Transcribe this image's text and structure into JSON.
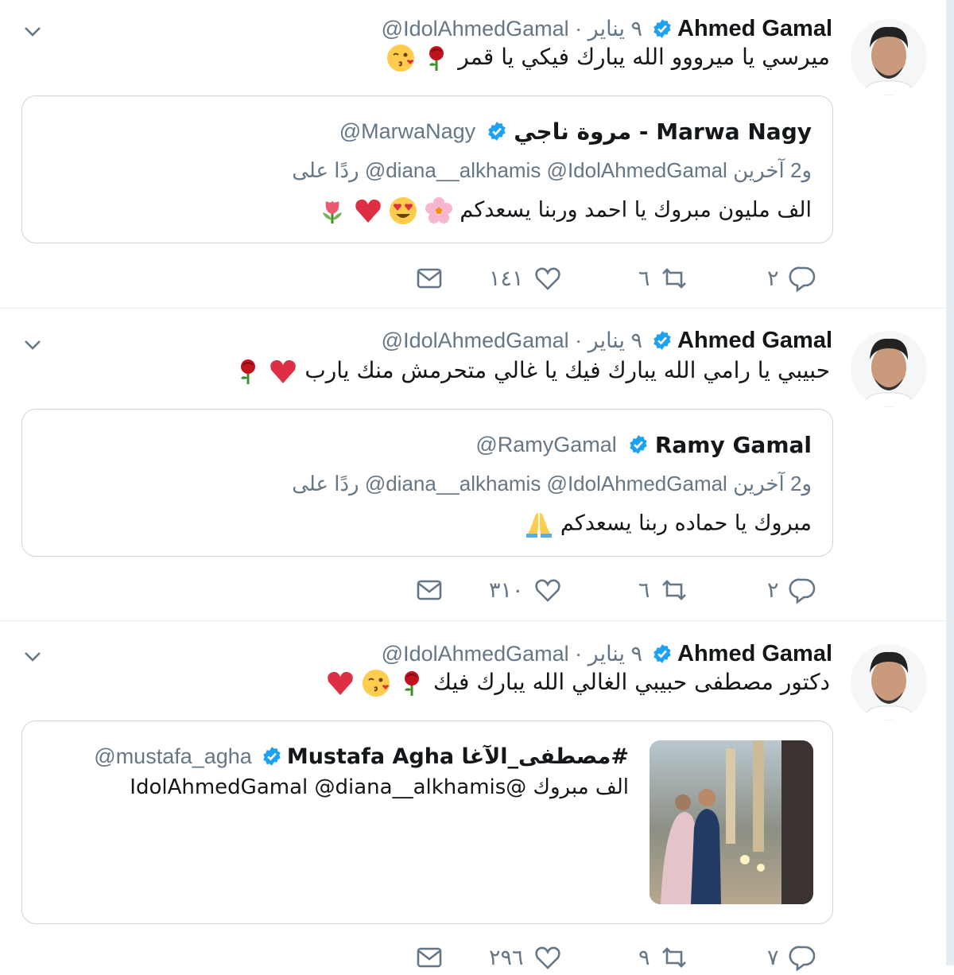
{
  "colors": {
    "verified": "#1da1f2",
    "muted": "#657786",
    "border": "#ccd6dd",
    "heart": "#e0245e"
  },
  "tweets": [
    {
      "name": "Ahmed Gamal",
      "meta": "@IdolAhmedGamal · ٩ يناير",
      "text": "ميرسي يا ميرووو الله يبارك فيكي يا قمر",
      "emojis": [
        "rose-icon",
        "kiss-face-icon"
      ],
      "quote": {
        "name": "مروة ناجي - Marwa Nagy",
        "handle": "@MarwaNagy",
        "replying": "ردًا على @diana__alkhamis @IdolAhmedGamal و2 آخرين",
        "text": "الف مليون مبروك يا احمد وربنا يسعدكم",
        "emojis": [
          "cherry-blossom-icon",
          "heart-eyes-icon",
          "red-heart-icon",
          "tulip-icon"
        ]
      },
      "actions": {
        "replies": "٢",
        "retweets": "٦",
        "likes": "١٤١"
      }
    },
    {
      "name": "Ahmed Gamal",
      "meta": "@IdolAhmedGamal · ٩ يناير",
      "text": "حبيبي يا رامي الله يبارك فيك يا غالي متحرمش منك يارب",
      "emojis": [
        "red-heart-icon",
        "rose-icon"
      ],
      "quote": {
        "name": "Ramy Gamal",
        "handle": "@RamyGamal",
        "replying": "ردًا على @diana__alkhamis @IdolAhmedGamal و2 آخرين",
        "text": "مبروك يا حماده ربنا يسعدكم",
        "emojis": [
          "folded-hands-icon"
        ]
      },
      "actions": {
        "replies": "٢",
        "retweets": "٦",
        "likes": "٣١٠"
      }
    },
    {
      "name": "Ahmed Gamal",
      "meta": "@IdolAhmedGamal · ٩ يناير",
      "text": "دكتور مصطفى حبيبي الغالي الله يبارك فيك",
      "emojis": [
        "rose-icon",
        "kiss-face-icon",
        "red-heart-icon"
      ],
      "quote": {
        "name": "#مصطفى_الآغا Mustafa Agha",
        "handle": "@mustafa_agha",
        "text": "الف مبروك @IdolAhmedGamal @diana__alkhamis"
      },
      "actions": {
        "replies": "٧",
        "retweets": "٩",
        "likes": "٢٩٦"
      }
    }
  ]
}
